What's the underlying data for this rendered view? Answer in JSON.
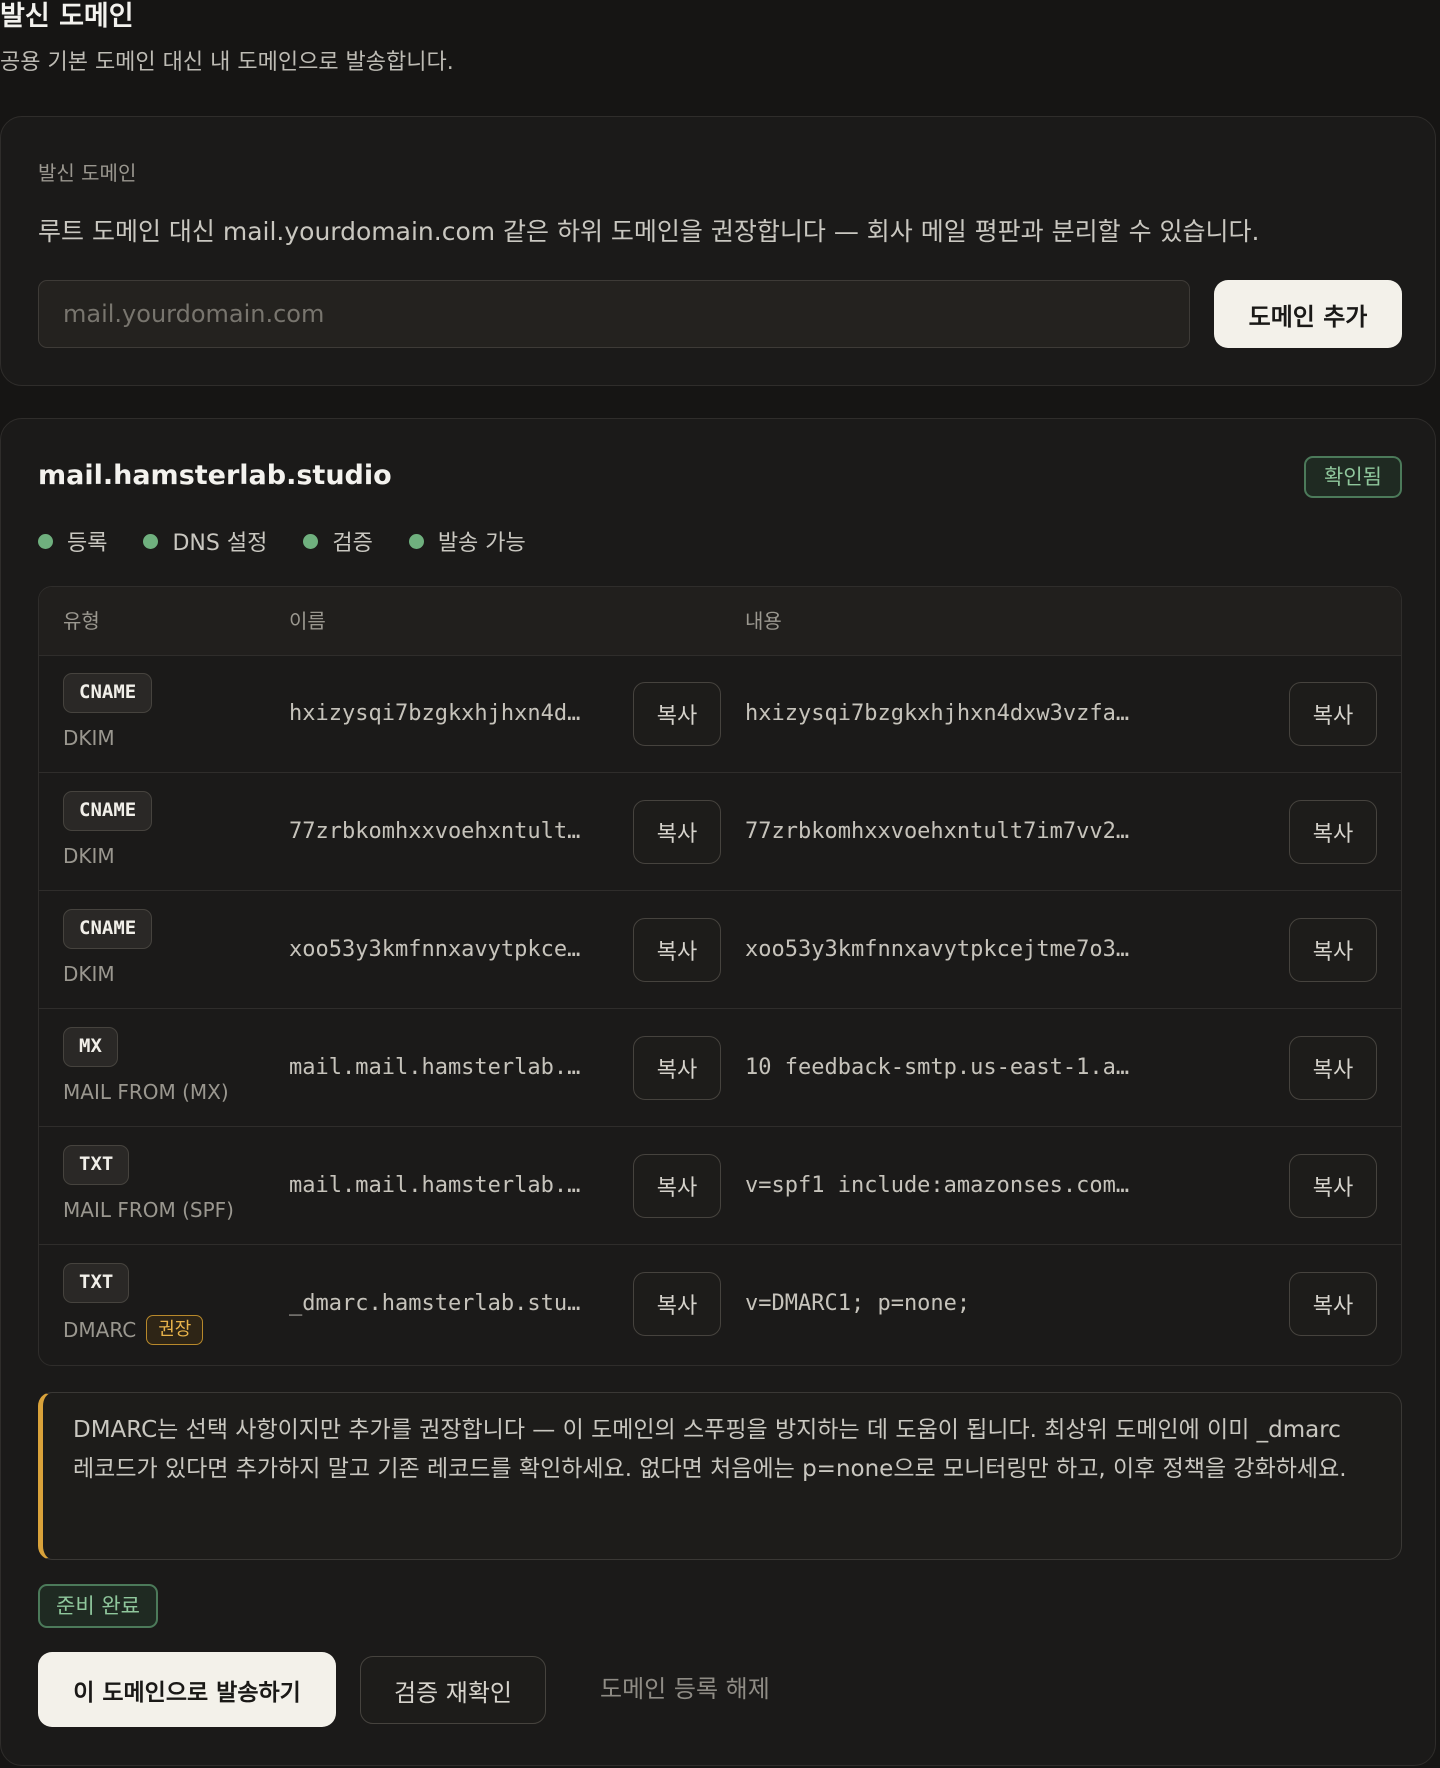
{
  "page": {
    "title": "발신 도메인",
    "subtitle": "공용 기본 도메인 대신 내 도메인으로 발송합니다."
  },
  "add_domain": {
    "label": "발신 도메인",
    "hint": "루트 도메인 대신 mail.yourdomain.com 같은 하위 도메인을 권장합니다 — 회사 메일 평판과 분리할 수 있습니다.",
    "input_value": "",
    "placeholder": "mail.yourdomain.com",
    "button_label": "도메인 추가"
  },
  "domain": {
    "name": "mail.hamsterlab.studio",
    "status_badge": "확인됨",
    "steps": [
      "등록",
      "DNS 설정",
      "검증",
      "발송 가능"
    ],
    "table": {
      "headers": {
        "type": "유형",
        "name": "이름",
        "content": "내용"
      },
      "copy_label": "복사",
      "rows": [
        {
          "type": "CNAME",
          "purpose": "DKIM",
          "name": "hxizysqi7bzgkxhjhxn4d…",
          "content": "hxizysqi7bzgkxhjhxn4dxw3vzfa…"
        },
        {
          "type": "CNAME",
          "purpose": "DKIM",
          "name": "77zrbkomhxxvoehxntult…",
          "content": "77zrbkomhxxvoehxntult7im7vv2…"
        },
        {
          "type": "CNAME",
          "purpose": "DKIM",
          "name": "xoo53y3kmfnnxavytpkce…",
          "content": "xoo53y3kmfnnxavytpkcejtme7o3…"
        },
        {
          "type": "MX",
          "purpose": "MAIL FROM (MX)",
          "name": "mail.mail.hamsterlab.…",
          "content": "10 feedback-smtp.us-east-1.a…"
        },
        {
          "type": "TXT",
          "purpose": "MAIL FROM (SPF)",
          "name": "mail.mail.hamsterlab.…",
          "content": "v=spf1 include:amazonses.com…"
        },
        {
          "type": "TXT",
          "purpose": "DMARC",
          "badge": "권장",
          "name": "_dmarc.hamsterlab.stu…",
          "content": "v=DMARC1; p=none;"
        }
      ]
    },
    "notice": "DMARC는 선택 사항이지만 추가를 권장합니다 — 이 도메인의 스푸핑을 방지하는 데 도움이 됩니다. 최상위 도메인에 이미 _dmarc 레코드가 있다면 추가하지 말고 기존 레코드를 확인하세요. 없다면 처음에는 p=none으로 모니터링만 하고, 이후 정책을 강화하세요.",
    "ready_badge": "준비 완료",
    "actions": {
      "send": "이 도메인으로 발송하기",
      "reverify": "검증 재확인",
      "unregister": "도메인 등록 해제"
    }
  },
  "colors": {
    "background": "#161514",
    "card": "#1b1a19",
    "success": "#6fb07e",
    "warning": "#d9a23a",
    "primary_button": "#f3f1ea"
  }
}
